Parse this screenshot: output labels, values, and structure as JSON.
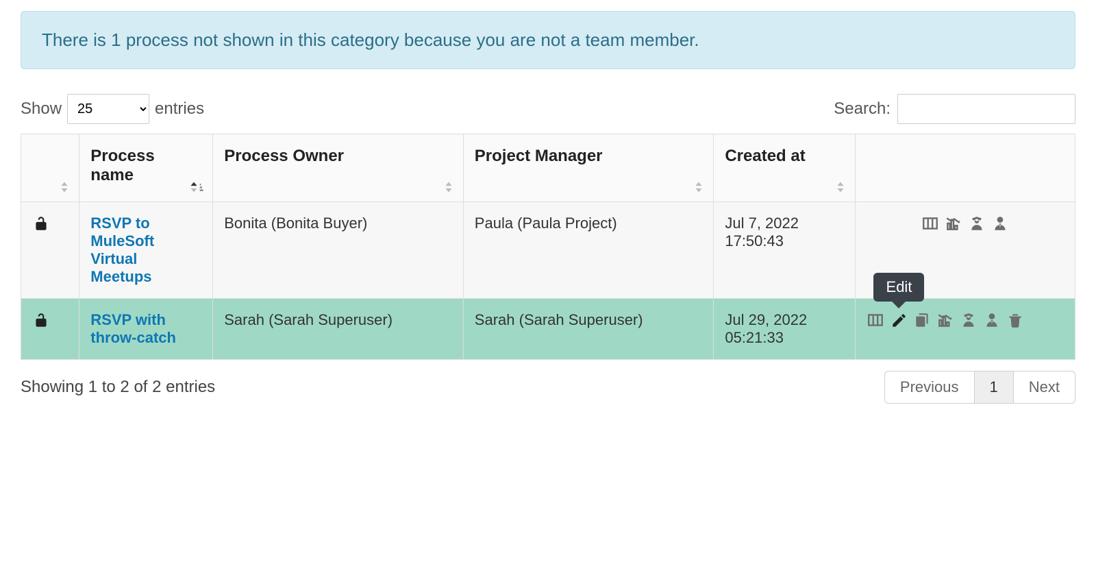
{
  "alert": {
    "message": "There is 1 process not shown in this category because you are not a team member."
  },
  "length_menu": {
    "show_label": "Show",
    "entries_label": "entries",
    "selected": "25"
  },
  "search": {
    "label": "Search:",
    "value": ""
  },
  "columns": {
    "lock": "",
    "name": "Process name",
    "owner": "Process Owner",
    "pm": "Project Manager",
    "created": "Created at",
    "actions": ""
  },
  "rows": [
    {
      "locked": false,
      "name": "RSVP to MuleSoft Virtual Meetups",
      "owner": "Bonita (Bonita Buyer)",
      "pm": "Paula (Paula Project)",
      "created": "Jul 7, 2022 17:50:43",
      "action_set": "short"
    },
    {
      "locked": false,
      "name": "RSVP with throw-catch",
      "owner": "Sarah (Sarah Superuser)",
      "pm": "Sarah (Sarah Superuser)",
      "created": "Jul 29, 2022 05:21:33",
      "action_set": "full"
    }
  ],
  "tooltip": {
    "edit": "Edit"
  },
  "info": "Showing 1 to 2 of 2 entries",
  "paginate": {
    "previous": "Previous",
    "page": "1",
    "next": "Next"
  }
}
